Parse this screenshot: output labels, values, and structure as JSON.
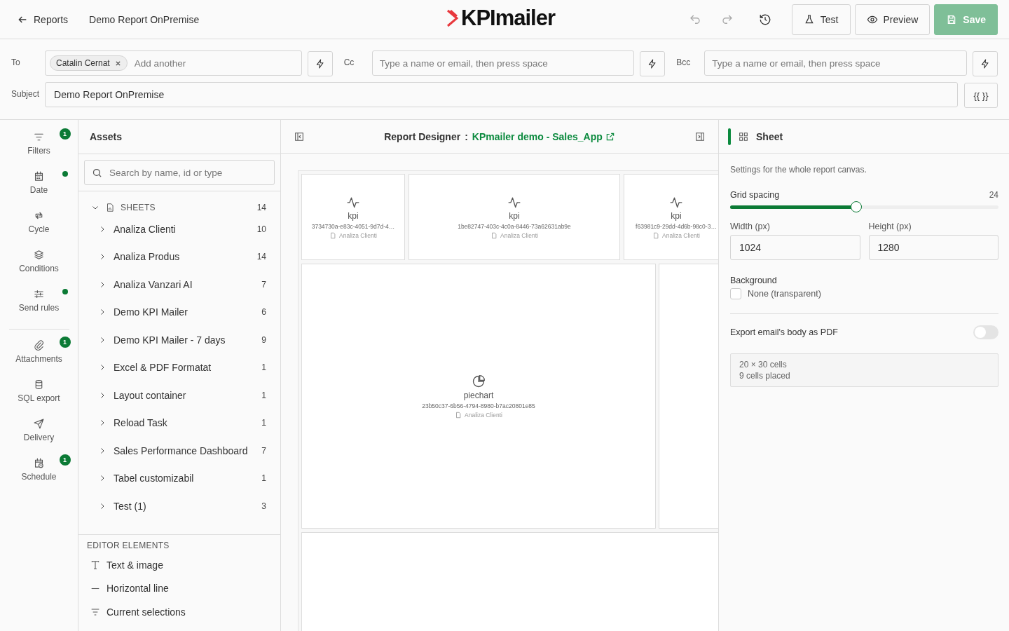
{
  "header": {
    "back": "Reports",
    "title": "Demo Report OnPremise",
    "logo": "KPImailer",
    "undo": {
      "disabled": true
    },
    "redo": {
      "disabled": true
    },
    "buttons": [
      {
        "kind": "test",
        "label": "Test",
        "disabled": false
      },
      {
        "kind": "preview",
        "label": "Preview",
        "disabled": false
      },
      {
        "kind": "save",
        "label": "Save",
        "disabled": true
      }
    ]
  },
  "recipients": [
    {
      "label": "To",
      "chips": [
        "Catalin Cernat"
      ],
      "placeholder": "Add another"
    },
    {
      "label": "Cc",
      "placeholder": "Type a name or email, then press space"
    },
    {
      "label": "Bcc",
      "placeholder": "Type a name or email, then press space"
    }
  ],
  "subject": {
    "label": "Subject",
    "value": "Demo Report OnPremise",
    "variables_button": "{{ }}"
  },
  "rail": [
    {
      "label": "Filters",
      "badge": "1",
      "dot": false
    },
    {
      "label": "Date",
      "dot": true
    },
    {
      "label": "Cycle",
      "dot": false
    },
    {
      "label": "Conditions",
      "dot": false
    },
    {
      "label": "Send rules",
      "dot": true
    },
    {
      "label": "Attachments",
      "badge": "1",
      "dot": false
    },
    {
      "label": "SQL export",
      "dot": false
    },
    {
      "label": "Delivery",
      "dot": false
    },
    {
      "label": "Schedule",
      "badge": "1",
      "dot": false
    }
  ],
  "assets": {
    "title": "Assets",
    "search_placeholder": "Search by name, id or type",
    "tree": {
      "label": "SHEETS",
      "count": "14",
      "expanded": true,
      "children": [
        {
          "label": "Analiza Clienti",
          "count": "10",
          "expanded": false
        },
        {
          "label": "Analiza Produs",
          "count": "14",
          "expanded": false
        },
        {
          "label": "Analiza Vanzari AI",
          "count": "7",
          "expanded": false
        },
        {
          "label": "Demo KPI Mailer",
          "count": "6",
          "expanded": false
        },
        {
          "label": "Demo KPI Mailer - 7 days",
          "count": "9",
          "expanded": false
        },
        {
          "label": "Excel & PDF Formatat",
          "count": "1",
          "expanded": false
        },
        {
          "label": "Layout container",
          "count": "1",
          "expanded": false
        },
        {
          "label": "Reload Task",
          "count": "1",
          "expanded": false
        },
        {
          "label": "Sales Performance Dashboard",
          "count": "7",
          "expanded": false
        },
        {
          "label": "Tabel customizabil",
          "count": "1",
          "expanded": false
        },
        {
          "label": "Test (1)",
          "count": "3",
          "expanded": false
        }
      ]
    },
    "editor_title": "EDITOR ELEMENTS",
    "editor_elements": [
      {
        "kind": "text",
        "label": "Text & image"
      },
      {
        "kind": "line",
        "label": "Horizontal line"
      },
      {
        "kind": "selections",
        "label": "Current selections"
      }
    ]
  },
  "designer": {
    "title": "Report Designer",
    "separator": ":",
    "app": "KPmailer demo - Sales_App",
    "cells": [
      {
        "kind": "kpi",
        "type": "kpi",
        "id": "3734730a-e83c-4051-9d7d-4…",
        "sheet": "Analiza Clienti"
      },
      {
        "kind": "kpi",
        "type": "kpi",
        "id": "1be82747-403c-4c0a-8446-73a62631ab9e",
        "sheet": "Analiza Clienti"
      },
      {
        "kind": "kpi",
        "type": "kpi",
        "id": "f63981c9-29dd-4d6b-98c0-3…",
        "sheet": "Analiza Clienti"
      },
      {
        "kind": "piechart",
        "type": "piechart",
        "id": "23b50c37-6b56-4794-8980-b7ac20801e85",
        "sheet": "Analiza Clienti"
      },
      {
        "kind": "empty"
      },
      {
        "kind": "empty"
      }
    ]
  },
  "sheet_panel": {
    "title": "Sheet",
    "description": "Settings for the whole report canvas.",
    "grid_spacing": {
      "label": "Grid spacing",
      "reading": "24",
      "level": 0.47
    },
    "width": {
      "label": "Width (px)",
      "value": "1024"
    },
    "height": {
      "label": "Height (px)",
      "value": "1280"
    },
    "background": {
      "label": "Background",
      "option": "None (transparent)",
      "checked": false
    },
    "export_pdf": {
      "label": "Export email's body as PDF",
      "on": false
    },
    "info": [
      "20 × 30 cells",
      "9 cells placed"
    ]
  }
}
